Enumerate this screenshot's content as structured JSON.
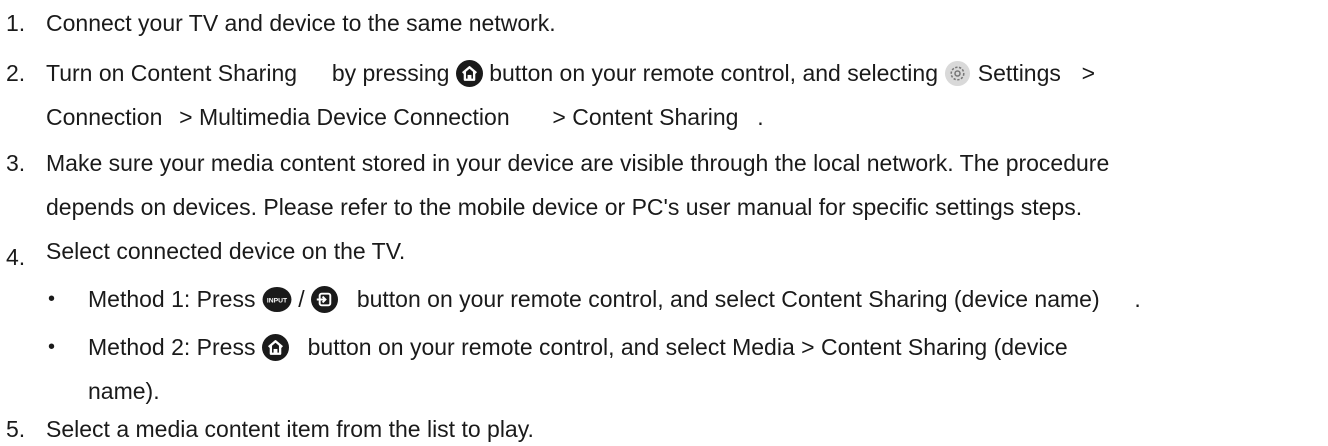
{
  "steps": [
    {
      "num": "1.",
      "text": "Connect your TV and device to the same network."
    },
    {
      "num": "2.",
      "p1": "Turn on Content Sharing",
      "p2": "by pressing",
      "p3": "button on your remote control, and selecting",
      "p4": "Settings",
      "p5": ">",
      "line2_p1": "Connection",
      "line2_p2": "> Multimedia Device Connection",
      "line2_p3": "> Content Sharing",
      "line2_p4": "."
    },
    {
      "num": "3.",
      "line1": "Make sure your media content stored in your device are visible through the local network. The procedure",
      "line2": "depends on devices. Please refer to the mobile device or PC's user manual for specific settings steps."
    },
    {
      "num": "4.",
      "text": "Select connected device on the TV."
    },
    {
      "num": "5.",
      "text": "Select a media content item from the list to play."
    }
  ],
  "methods": [
    {
      "bullet": "•",
      "p1": "Method 1: Press",
      "slash": "/",
      "p2": "button on your remote control, and select Content Sharing (device name)",
      "p3": "."
    },
    {
      "bullet": "•",
      "p1": "Method 2: Press",
      "p2": "button on your remote control, and select Media > Content Sharing (device",
      "line2": "name)."
    }
  ],
  "icons": {
    "home": "home-icon",
    "settings": "settings-gear-icon",
    "input_label": "INPUT",
    "input": "input-source-icon"
  },
  "colors": {
    "text": "#1a1a1a",
    "icon_dark": "#1a1a1a",
    "gear_bg": "#d9d9d9"
  }
}
